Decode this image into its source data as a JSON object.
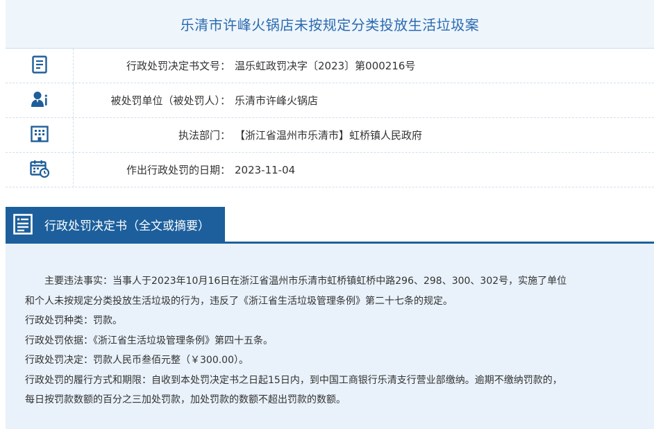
{
  "page": {
    "title": "乐清市许峰火锅店未按规定分类投放生活垃圾案"
  },
  "info": [
    {
      "icon": "document-icon",
      "label": "行政处罚决定书文号：",
      "value": "温乐虹政罚决字〔2023〕第000216号"
    },
    {
      "icon": "user-icon",
      "label": "被处罚单位（被处罚人）：",
      "value": "乐清市许峰火锅店"
    },
    {
      "icon": "building-icon",
      "label": "执法部门：",
      "value": "【浙江省温州市乐清市】虹桥镇人民政府"
    },
    {
      "icon": "calendar-icon",
      "label": "作出行政处罚的日期：",
      "value": "2023-11-04"
    }
  ],
  "section": {
    "icon": "document-list-icon",
    "title": "行政处罚决定书（全文或摘要）"
  },
  "content": {
    "facts_line1": "主要违法事实：当事人于2023年10月16日在浙江省温州市乐清市虹桥镇虹桥中路296、298、300、302号，实施了单位",
    "facts_line2": "和个人未按规定分类投放生活垃圾的行为，违反了《浙江省生活垃圾管理条例》第二十七条的规定。",
    "type": "行政处罚种类：罚款。",
    "basis": "行政处罚依据：《浙江省生活垃圾管理条例》第四十五条。",
    "decision": "行政处罚决定：罚款人民币叁佰元整（￥300.00）。",
    "method_line1": "行政处罚的履行方式和期限：自收到本处罚决定书之日起15日内，到中国工商银行乐清支行营业部缴纳。逾期不缴纳罚款的，",
    "method_line2": "每日按罚款数额的百分之三加处罚款，加处罚款的数额不超出罚款的数额。"
  },
  "colors": {
    "title_text": "#2a6ab0",
    "header_blue": "#1c5f9c",
    "content_bg": "#e9f2fa",
    "icon_blue": "#1f5e9a"
  }
}
